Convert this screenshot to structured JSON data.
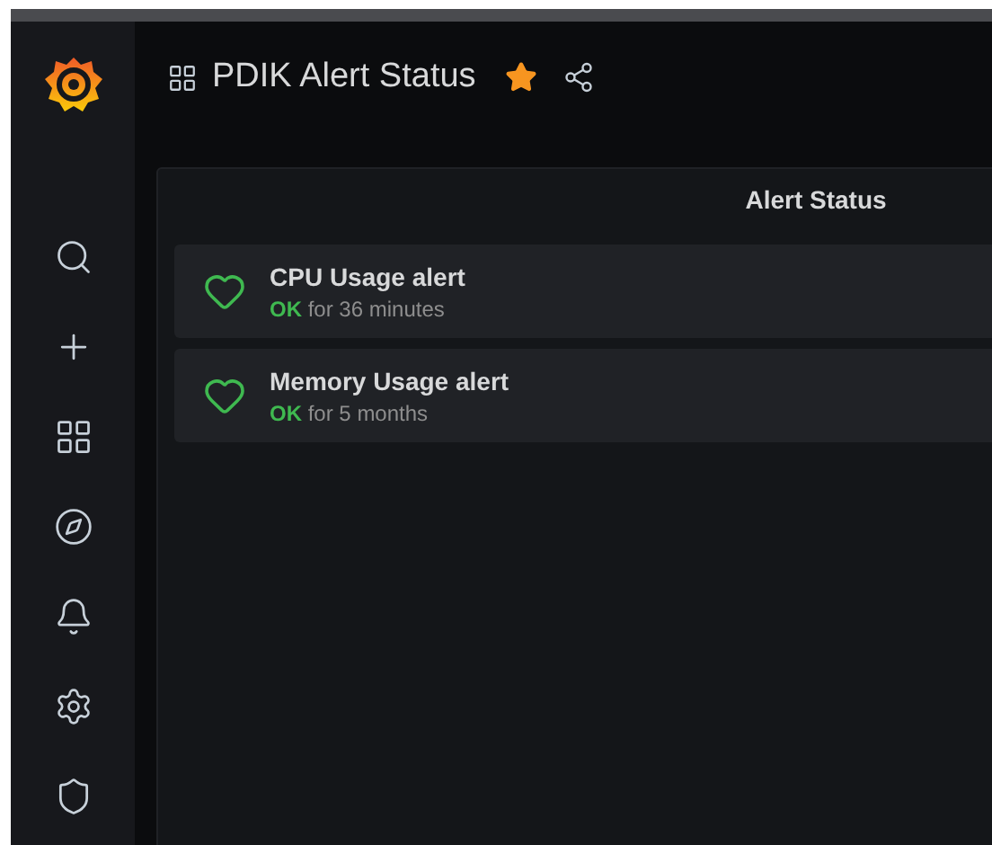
{
  "dashboard": {
    "title": "PDIK Alert Status",
    "starred": true
  },
  "panel": {
    "title": "Alert Status",
    "alerts": [
      {
        "name": "CPU Usage alert",
        "kind": "ok",
        "state_label": "OK",
        "duration": "for 36 minutes"
      },
      {
        "name": "Memory Usage alert",
        "kind": "ok",
        "state_label": "OK",
        "duration": "for 5 months"
      }
    ]
  }
}
